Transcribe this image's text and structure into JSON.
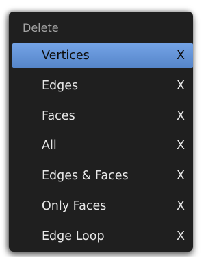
{
  "menu": {
    "title": "Delete",
    "items": [
      {
        "label": "Vertices",
        "shortcut": "X",
        "highlighted": true
      },
      {
        "label": "Edges",
        "shortcut": "X"
      },
      {
        "label": "Faces",
        "shortcut": "X"
      },
      {
        "label": "All",
        "shortcut": "X"
      },
      {
        "label": "Edges & Faces",
        "shortcut": "X"
      },
      {
        "label": "Only Faces",
        "shortcut": "X"
      },
      {
        "label": "Edge Loop",
        "shortcut": "X"
      }
    ]
  },
  "colors": {
    "menu_background": "#1f1f1f",
    "highlight": "#6596da",
    "title_text": "#a3a3a3",
    "item_text": "#e8e8e8"
  }
}
